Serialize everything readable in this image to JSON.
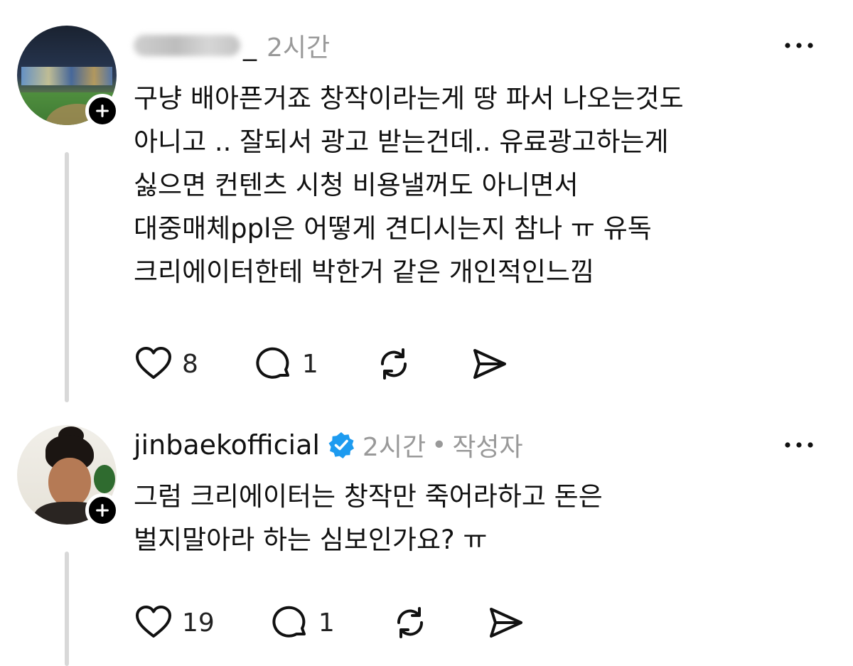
{
  "posts": [
    {
      "username_visible_tail": "_",
      "time": "2시간",
      "lines": [
        "구냥 배아픈거죠 창작이라는게 땅 파서 나오는것도",
        "아니고 .. 잘되서 광고 받는건데.. 유료광고하는게",
        "싫으면 컨텐츠 시청 비용낼꺼도 아니면서",
        "대중매체ppl은 어떻게 견디시는지 참나 ㅠ 유독",
        "크리에이터한테 박한거 같은 개인적인느낌"
      ],
      "likes": "8",
      "replies": "1",
      "avatar_icon": "stadium-photo"
    },
    {
      "username": "jinbaekofficial",
      "verified": true,
      "time": "2시간",
      "separator": "•",
      "author_label": "작성자",
      "lines": [
        "그럼 크리에이터는 창작만 죽어라하고 돈은",
        "벌지말아라 하는 심보인가요? ㅠ"
      ],
      "likes": "19",
      "replies": "1",
      "avatar_icon": "person-photo"
    }
  ],
  "icons": {
    "like": "heart-icon",
    "reply": "comment-icon",
    "repost": "repost-icon",
    "share": "send-icon",
    "more": "more-icon",
    "follow": "plus-icon",
    "verified": "verified-badge-icon"
  },
  "colors": {
    "text": "#111111",
    "meta": "#999999",
    "thread_line": "#d8d8d8",
    "verified": "#1d9bf0"
  }
}
